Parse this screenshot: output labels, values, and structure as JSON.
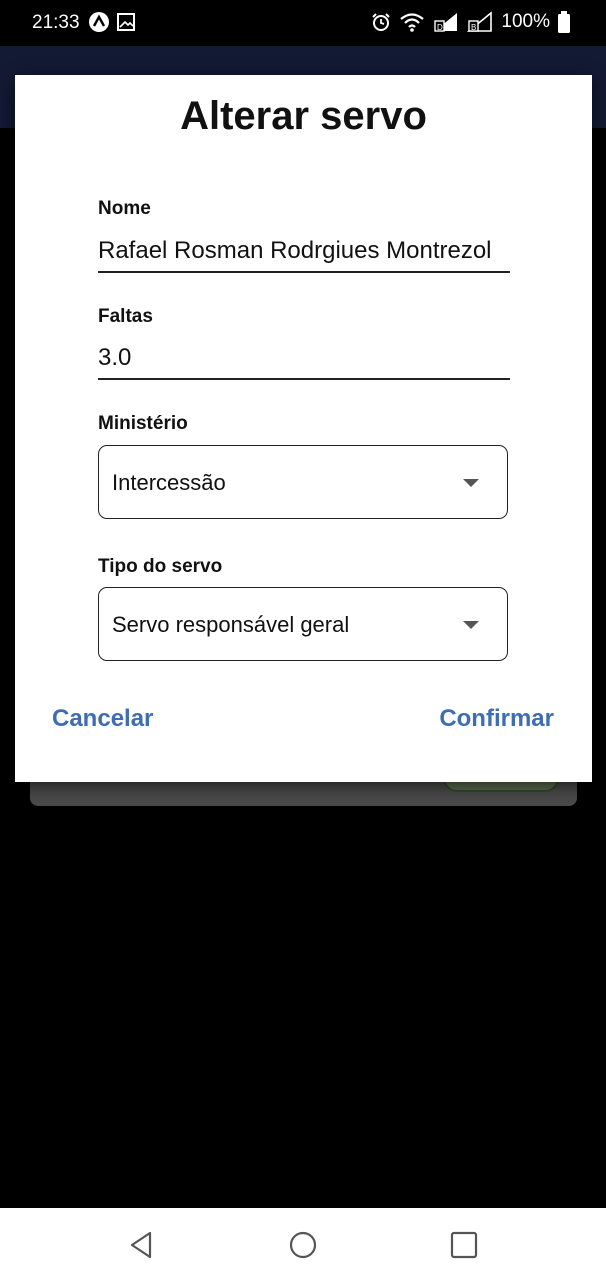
{
  "status_bar": {
    "time": "21:33",
    "battery": "100%",
    "icons": [
      "app-notification-icon",
      "image-notification-icon",
      "alarm-icon",
      "wifi-icon",
      "signal-icon",
      "signal-icon-2",
      "battery-icon"
    ]
  },
  "dialog": {
    "title": "Alterar servo",
    "name_label": "Nome",
    "name_value": "Rafael Rosman Rodrgiues Montrezol",
    "faltas_label": "Faltas",
    "faltas_value": "3.0",
    "ministerio_label": "Ministério",
    "ministerio_value": "Intercessão",
    "tipo_label": "Tipo do servo",
    "tipo_value": "Servo responsável geral",
    "cancel_label": "Cancelar",
    "confirm_label": "Confirmar"
  },
  "colors": {
    "accent": "#3e6db4",
    "app_bar": "#131a33"
  },
  "nav": {
    "icons": [
      "back-icon",
      "home-icon",
      "recents-icon"
    ]
  }
}
